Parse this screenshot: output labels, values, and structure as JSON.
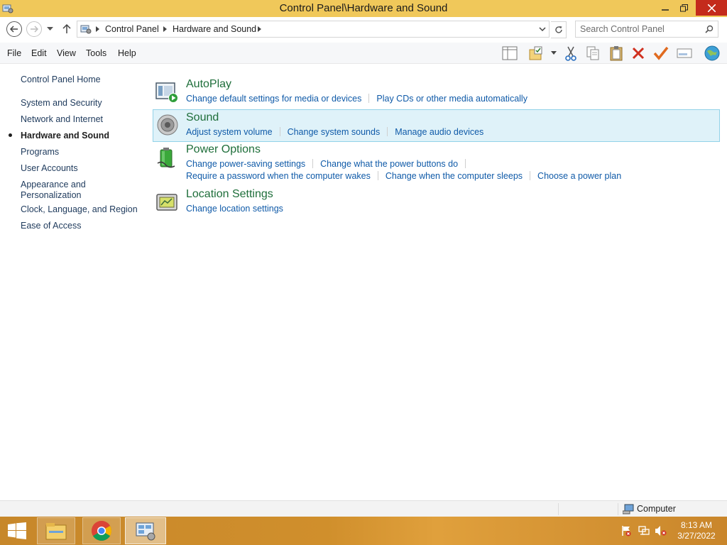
{
  "window": {
    "title": "Control Panel\\Hardware and Sound",
    "close_label": "✕"
  },
  "address": {
    "crumbs": [
      "Control Panel",
      "Hardware and Sound"
    ],
    "search_placeholder": "Search Control Panel"
  },
  "menu": [
    "File",
    "Edit",
    "View",
    "Tools",
    "Help"
  ],
  "toolbar_icons": [
    "layout-pane-icon",
    "folder-options-icon",
    "cut-icon",
    "copy-icon",
    "paste-icon",
    "delete-icon",
    "checkmark-icon",
    "properties-icon",
    "globe-icon"
  ],
  "sidebar": {
    "home": "Control Panel Home",
    "items": [
      "System and Security",
      "Network and Internet",
      "Hardware and Sound",
      "Programs",
      "User Accounts",
      "Appearance and Personalization",
      "Clock, Language, and Region",
      "Ease of Access"
    ],
    "appearance_line1": "Appearance and",
    "appearance_line2": "Personalization",
    "current": "Hardware and Sound"
  },
  "categories": [
    {
      "title": "AutoPlay",
      "icon": "autoplay-icon",
      "links": [
        "Change default settings for media or devices",
        "Play CDs or other media automatically"
      ]
    },
    {
      "title": "Sound",
      "icon": "speaker-icon",
      "links": [
        "Adjust system volume",
        "Change system sounds",
        "Manage audio devices"
      ]
    },
    {
      "title": "Power Options",
      "icon": "battery-icon",
      "links": [
        "Change power-saving settings",
        "Change what the power buttons do",
        "Require a password when the computer wakes",
        "Change when the computer sleeps",
        "Choose a power plan"
      ]
    },
    {
      "title": "Location Settings",
      "icon": "location-device-icon",
      "links": [
        "Change location settings"
      ]
    }
  ],
  "statusbar": {
    "computer": "Computer"
  },
  "taskbar": {
    "apps": [
      "file-explorer-icon",
      "chrome-icon",
      "control-panel-icon"
    ],
    "time": "8:13 AM",
    "date": "3/27/2022"
  },
  "colors": {
    "titlebar": "#f0c85a",
    "link": "#0f5aa8",
    "category_title": "#1e6e3a",
    "hover_bg": "#dff2f9",
    "taskbar": "#d08f2c",
    "close_button": "#c42b1c"
  }
}
